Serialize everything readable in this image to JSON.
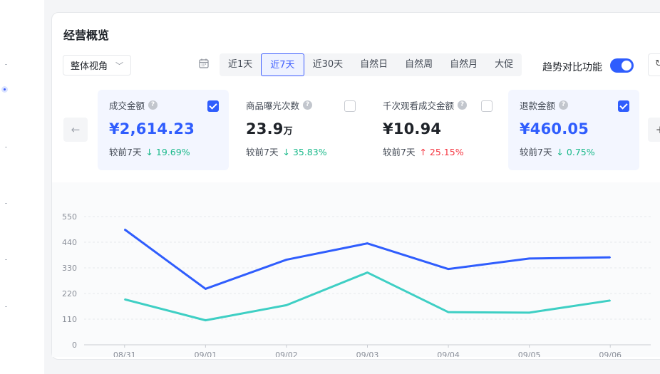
{
  "panel": {
    "title": "经营概览"
  },
  "view_select": {
    "value": "整体视角"
  },
  "time_tabs": [
    "近1天",
    "近7天",
    "近30天",
    "自然日",
    "自然周",
    "自然月",
    "大促"
  ],
  "active_tab_index": 1,
  "toggle": {
    "label": "趋势对比功能",
    "on": true
  },
  "cards": [
    {
      "name": "成交金额",
      "value": "¥2,614.23",
      "unit": "",
      "compare_label": "较前7天",
      "arrow": "↓",
      "change": "19.69%",
      "direction": "down",
      "checked": true
    },
    {
      "name": "商品曝光次数",
      "value": "23.9",
      "unit": "万",
      "compare_label": "较前7天",
      "arrow": "↓",
      "change": "35.83%",
      "direction": "down",
      "checked": false
    },
    {
      "name": "千次观看成交金额",
      "value": "¥10.94",
      "unit": "",
      "compare_label": "较前7天",
      "arrow": "↑",
      "change": "25.15%",
      "direction": "up",
      "checked": false
    },
    {
      "name": "退款金额",
      "value": "¥460.05",
      "unit": "",
      "compare_label": "较前7天",
      "arrow": "↓",
      "change": "0.75%",
      "direction": "down",
      "checked": true
    }
  ],
  "colors": {
    "accent": "#2f5dfd",
    "series_refund": "#3ecfc4",
    "down": "#19b98a",
    "up": "#f5343f"
  },
  "icons": {
    "calendar": "calendar-icon",
    "prev": "arrow-left-icon",
    "help": "question-circle-icon"
  },
  "chart_data": {
    "type": "line",
    "x": [
      "08/31",
      "09/01",
      "09/02",
      "09/03",
      "09/04",
      "09/05",
      "09/06"
    ],
    "series": [
      {
        "name": "成交金额",
        "color": "#2f5dfd",
        "values": [
          495,
          240,
          365,
          435,
          325,
          370,
          375
        ]
      },
      {
        "name": "退款金额",
        "color": "#3ecfc4",
        "values": [
          195,
          105,
          170,
          310,
          140,
          138,
          190
        ]
      }
    ],
    "y_ticks": [
      0,
      110,
      220,
      330,
      440,
      550
    ],
    "ylim": [
      0,
      550
    ],
    "legend": "top",
    "grid": true
  }
}
